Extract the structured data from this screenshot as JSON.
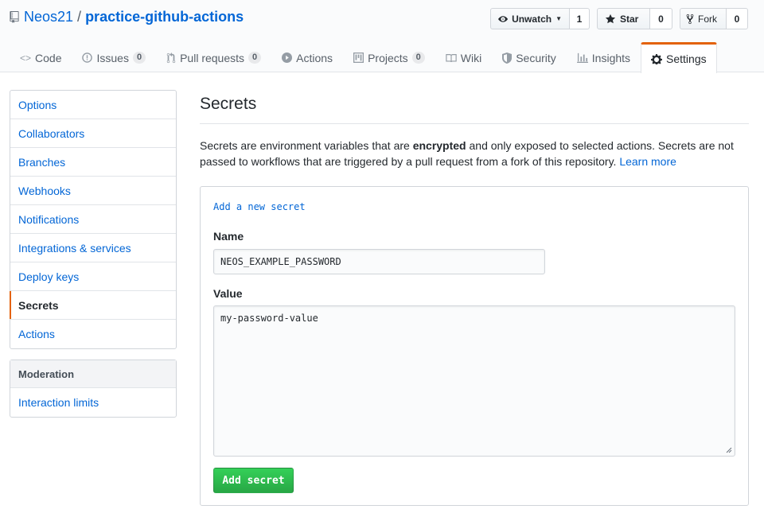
{
  "repo": {
    "owner": "Neos21",
    "separator": "/",
    "name": "practice-github-actions"
  },
  "header_actions": {
    "watch": {
      "label": "Unwatch",
      "count": "1"
    },
    "star": {
      "label": "Star",
      "count": "0"
    },
    "fork": {
      "label": "Fork",
      "count": "0"
    }
  },
  "tabs": [
    {
      "label": "Code",
      "icon": "code-icon"
    },
    {
      "label": "Issues",
      "icon": "issue-icon",
      "badge": "0"
    },
    {
      "label": "Pull requests",
      "icon": "pull-request-icon",
      "badge": "0"
    },
    {
      "label": "Actions",
      "icon": "play-icon"
    },
    {
      "label": "Projects",
      "icon": "project-icon",
      "badge": "0"
    },
    {
      "label": "Wiki",
      "icon": "book-icon"
    },
    {
      "label": "Security",
      "icon": "shield-icon"
    },
    {
      "label": "Insights",
      "icon": "graph-icon"
    },
    {
      "label": "Settings",
      "icon": "gear-icon",
      "selected": true
    }
  ],
  "sidebar": {
    "items": [
      "Options",
      "Collaborators",
      "Branches",
      "Webhooks",
      "Notifications",
      "Integrations & services",
      "Deploy keys",
      "Secrets",
      "Actions"
    ],
    "selected": "Secrets",
    "moderation_heading": "Moderation",
    "moderation_items": [
      "Interaction limits"
    ]
  },
  "main": {
    "title": "Secrets",
    "intro_part1": "Secrets are environment variables that are ",
    "intro_bold": "encrypted",
    "intro_part2": " and only exposed to selected actions. Secrets are not passed to workflows that are triggered by a pull request from a fork of this repository. ",
    "learn_more": "Learn more",
    "form": {
      "heading": "Add a new secret",
      "name_label": "Name",
      "name_value": "NEOS_EXAMPLE_PASSWORD",
      "value_label": "Value",
      "value_value": "my-password-value",
      "submit_label": "Add secret"
    }
  },
  "colors": {
    "link": "#0366d6",
    "accent": "#e36209",
    "success": "#28a745"
  }
}
